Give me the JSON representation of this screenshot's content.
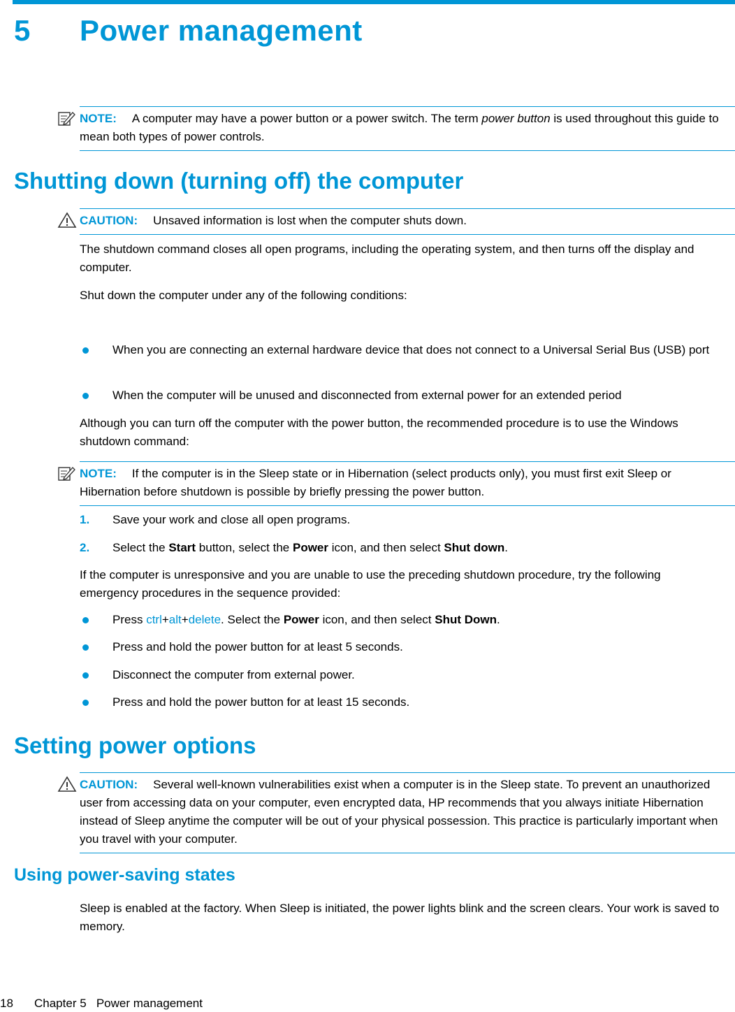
{
  "chapter": {
    "number": "5",
    "title": "Power management"
  },
  "note1": {
    "label": "NOTE:",
    "text_a": "A computer may have a power button or a power switch. The term ",
    "text_em": "power button",
    "text_b": " is used throughout this guide to mean both types of power controls."
  },
  "section1": {
    "heading": "Shutting down (turning off) the computer",
    "caution": {
      "label": "CAUTION:",
      "text": "Unsaved information is lost when the computer shuts down."
    },
    "para1": "The shutdown command closes all open programs, including the operating system, and then turns off the display and computer.",
    "para2": "Shut down the computer under any of the following conditions:",
    "conditions": [
      "When you are connecting an external hardware device that does not connect to a Universal Serial Bus (USB) port",
      "When the computer will be unused and disconnected from external power for an extended period"
    ],
    "para3": "Although you can turn off the computer with the power button, the recommended procedure is to use the Windows shutdown command:",
    "note2": {
      "label": "NOTE:",
      "text": "If the computer is in the Sleep state or in Hibernation (select products only), you must first exit Sleep or Hibernation before shutdown is possible by briefly pressing the power button."
    },
    "steps": [
      {
        "num": "1.",
        "text": "Save your work and close all open programs."
      },
      {
        "num": "2.",
        "t1": "Select the ",
        "b1": "Start",
        "t2": " button, select the ",
        "b2": "Power",
        "t3": " icon, and then select ",
        "b3": "Shut down",
        "t4": "."
      }
    ],
    "para4": "If the computer is unresponsive and you are unable to use the preceding shutdown procedure, try the following emergency procedures in the sequence provided:",
    "emergency": {
      "item1": {
        "t1": "Press ",
        "k1": "ctrl",
        "plus1": "+",
        "k2": "alt",
        "plus2": "+",
        "k3": "delete",
        "t2": ". Select the ",
        "b1": "Power",
        "t3": " icon, and then select ",
        "b2": "Shut Down",
        "t4": "."
      },
      "item2": "Press and hold the power button for at least 5 seconds.",
      "item3": "Disconnect the computer from external power.",
      "item4": "Press and hold the power button for at least 15 seconds."
    }
  },
  "section2": {
    "heading": "Setting power options",
    "caution": {
      "label": "CAUTION:",
      "text": "Several well-known vulnerabilities exist when a computer is in the Sleep state. To prevent an unauthorized user from accessing data on your computer, even encrypted data, HP recommends that you always initiate Hibernation instead of Sleep anytime the computer will be out of your physical possession. This practice is particularly important when you travel with your computer."
    }
  },
  "section3": {
    "heading": "Using power-saving states",
    "para": "Sleep is enabled at the factory. When Sleep is initiated, the power lights blink and the screen clears. Your work is saved to memory."
  },
  "footer": {
    "page": "18",
    "text": "Chapter 5   Power management"
  },
  "colors": {
    "accent": "#0096d6"
  }
}
